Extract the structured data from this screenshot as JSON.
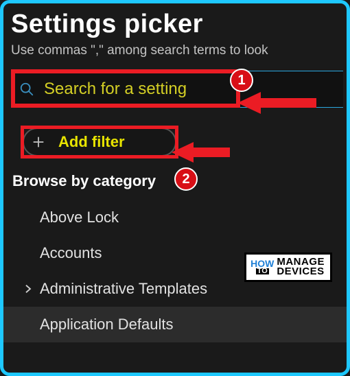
{
  "header": {
    "title": "Settings picker",
    "subtitle": "Use commas \",\" among search terms to look"
  },
  "search": {
    "placeholder": "Search for a setting"
  },
  "filter": {
    "label": "Add filter"
  },
  "browse": {
    "heading": "Browse by category",
    "items": [
      {
        "label": "Above Lock",
        "expandable": false
      },
      {
        "label": "Accounts",
        "expandable": false
      },
      {
        "label": "Administrative Templates",
        "expandable": true
      },
      {
        "label": "Application Defaults",
        "expandable": false,
        "selected": true
      }
    ]
  },
  "annotations": {
    "badge1": "1",
    "badge2": "2"
  },
  "watermark": {
    "how": "HOW",
    "to": "TO",
    "line1": "MANAGE",
    "line2": "DEVICES"
  }
}
